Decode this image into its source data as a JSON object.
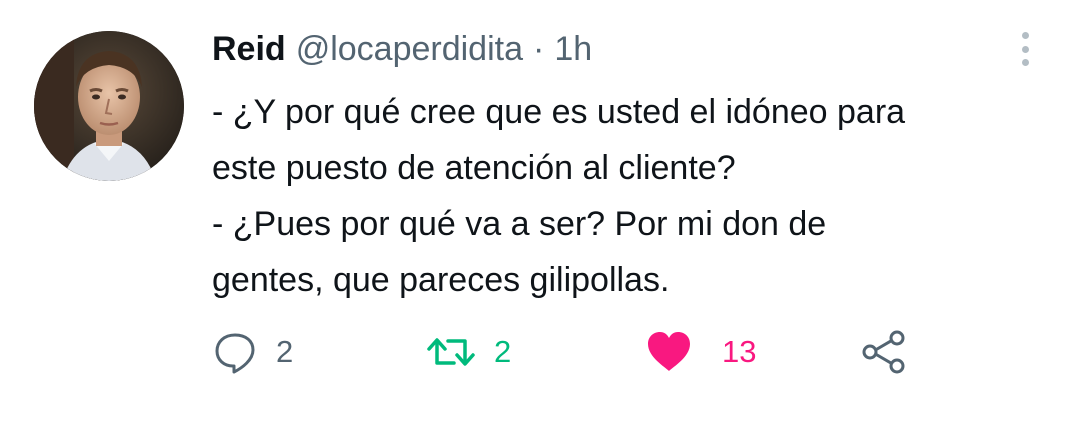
{
  "tweet": {
    "author": {
      "name": "Reid",
      "handle": "@locaperdidita",
      "separator": "·",
      "time": "1h"
    },
    "text_lines": [
      "- ¿Y por qué cree que es usted el idóneo para",
      "este puesto de atención al cliente?",
      "- ¿Pues por qué va a ser? Por mi don de",
      "gentes, que pareces gilipollas."
    ],
    "actions": {
      "reply_count": "2",
      "retweet_count": "2",
      "like_count": "13"
    },
    "colors": {
      "retweet": "#00ba7c",
      "like": "#f91880",
      "muted": "#536471"
    },
    "icons": [
      "more-vertical-icon",
      "reply-icon",
      "retweet-icon",
      "heart-icon",
      "share-icon"
    ]
  }
}
